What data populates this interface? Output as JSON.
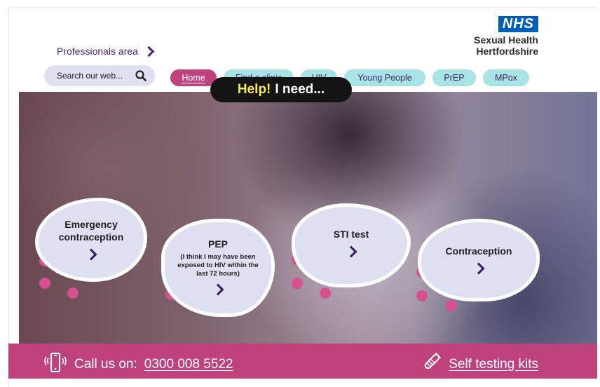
{
  "header": {
    "professionals_label": "Professionals area",
    "logo_badge": "NHS",
    "logo_line1": "Sexual Health",
    "logo_line2": "Hertfordshire"
  },
  "search": {
    "placeholder": "Search our web..."
  },
  "nav": {
    "items": [
      {
        "label": "Home",
        "active": true
      },
      {
        "label": "Find a clinic"
      },
      {
        "label": "HIV"
      },
      {
        "label": "Young People"
      },
      {
        "label": "PrEP"
      },
      {
        "label": "MPox"
      }
    ]
  },
  "hero": {
    "help_highlight": "Help!",
    "help_text": "I need...",
    "cards": [
      {
        "title_line1": "Emergency",
        "title_line2": "contraception"
      },
      {
        "title": "PEP",
        "subtitle": "(I think I may have been exposed to HIV within the last 72 hours)"
      },
      {
        "title": "STI test"
      },
      {
        "title": "Contraception"
      }
    ]
  },
  "footer": {
    "call_label": "Call us on:",
    "phone": "0300 008 5522",
    "kits_label": "Self testing kits"
  },
  "colors": {
    "brand_pink": "#c0427d",
    "nav_teal": "#a8e3e6",
    "nhs_blue": "#005eb8",
    "purple_text": "#4b1f73"
  }
}
